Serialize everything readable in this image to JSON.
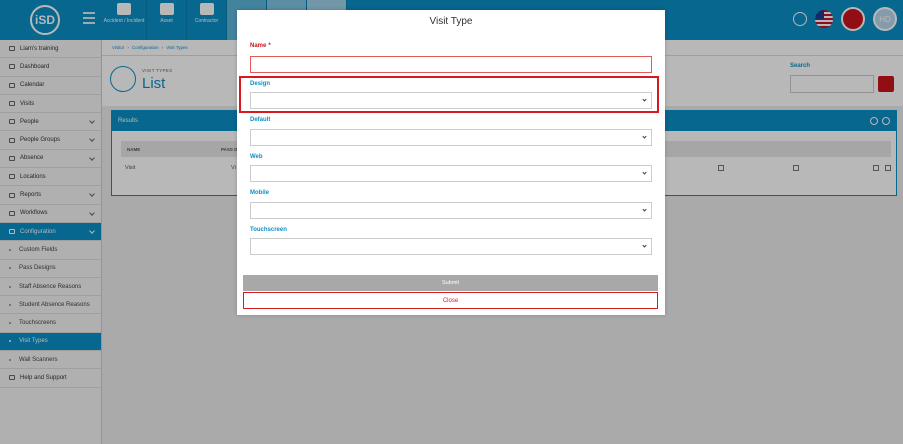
{
  "topbar": {
    "logo": "iSD",
    "tiles": [
      "Accident / Incident",
      "Asset",
      "Contractor"
    ],
    "avatar_initials": "HD"
  },
  "sidebar": {
    "items": [
      {
        "label": "Liam's training",
        "type": "main",
        "chevron": false,
        "active": false
      },
      {
        "label": "Dashboard",
        "type": "main",
        "chevron": false,
        "active": false
      },
      {
        "label": "Calendar",
        "type": "main",
        "chevron": false,
        "active": false
      },
      {
        "label": "Visits",
        "type": "main",
        "chevron": false,
        "active": false
      },
      {
        "label": "People",
        "type": "main",
        "chevron": true,
        "active": false
      },
      {
        "label": "People Groups",
        "type": "main",
        "chevron": true,
        "active": false
      },
      {
        "label": "Absence",
        "type": "main",
        "chevron": true,
        "active": false
      },
      {
        "label": "Locations",
        "type": "main",
        "chevron": false,
        "active": false
      },
      {
        "label": "Reports",
        "type": "main",
        "chevron": true,
        "active": false
      },
      {
        "label": "Workflows",
        "type": "main",
        "chevron": true,
        "active": false
      },
      {
        "label": "Configuration",
        "type": "main",
        "chevron": true,
        "active": true
      },
      {
        "label": "Custom Fields",
        "type": "sub",
        "chevron": false,
        "active": false
      },
      {
        "label": "Pass Designs",
        "type": "sub",
        "chevron": false,
        "active": false
      },
      {
        "label": "Staff Absence Reasons",
        "type": "sub",
        "chevron": false,
        "active": false
      },
      {
        "label": "Student Absence Reasons",
        "type": "sub",
        "chevron": false,
        "active": false
      },
      {
        "label": "Touchscreens",
        "type": "sub",
        "chevron": false,
        "active": false
      },
      {
        "label": "Visit Types",
        "type": "sub",
        "chevron": false,
        "active": true
      },
      {
        "label": "Wall Scanners",
        "type": "sub",
        "chevron": false,
        "active": false
      },
      {
        "label": "Help and Support",
        "type": "main",
        "chevron": false,
        "active": false
      }
    ]
  },
  "breadcrumb": {
    "items": [
      "Visitor",
      "Configuration",
      "Visit Types"
    ]
  },
  "header": {
    "subtitle": "VISIT TYPES",
    "title": "List",
    "search_label": "Search"
  },
  "results": {
    "title": "Results",
    "columns": [
      "NAME",
      "PASS D"
    ],
    "row": {
      "name": "Visit",
      "pass": "Vi"
    }
  },
  "modal": {
    "title": "Visit Type",
    "name_label": "Name",
    "name_required": "*",
    "name_value": "",
    "design_label": "Design",
    "default_label": "Default",
    "web_label": "Web",
    "mobile_label": "Mobile",
    "touchscreen_label": "Touchscreen",
    "submit_label": "Submit",
    "close_label": "Close"
  },
  "colors": {
    "accent": "#0b8fc6",
    "danger": "#d71920",
    "disabled": "#a8a8a8"
  }
}
